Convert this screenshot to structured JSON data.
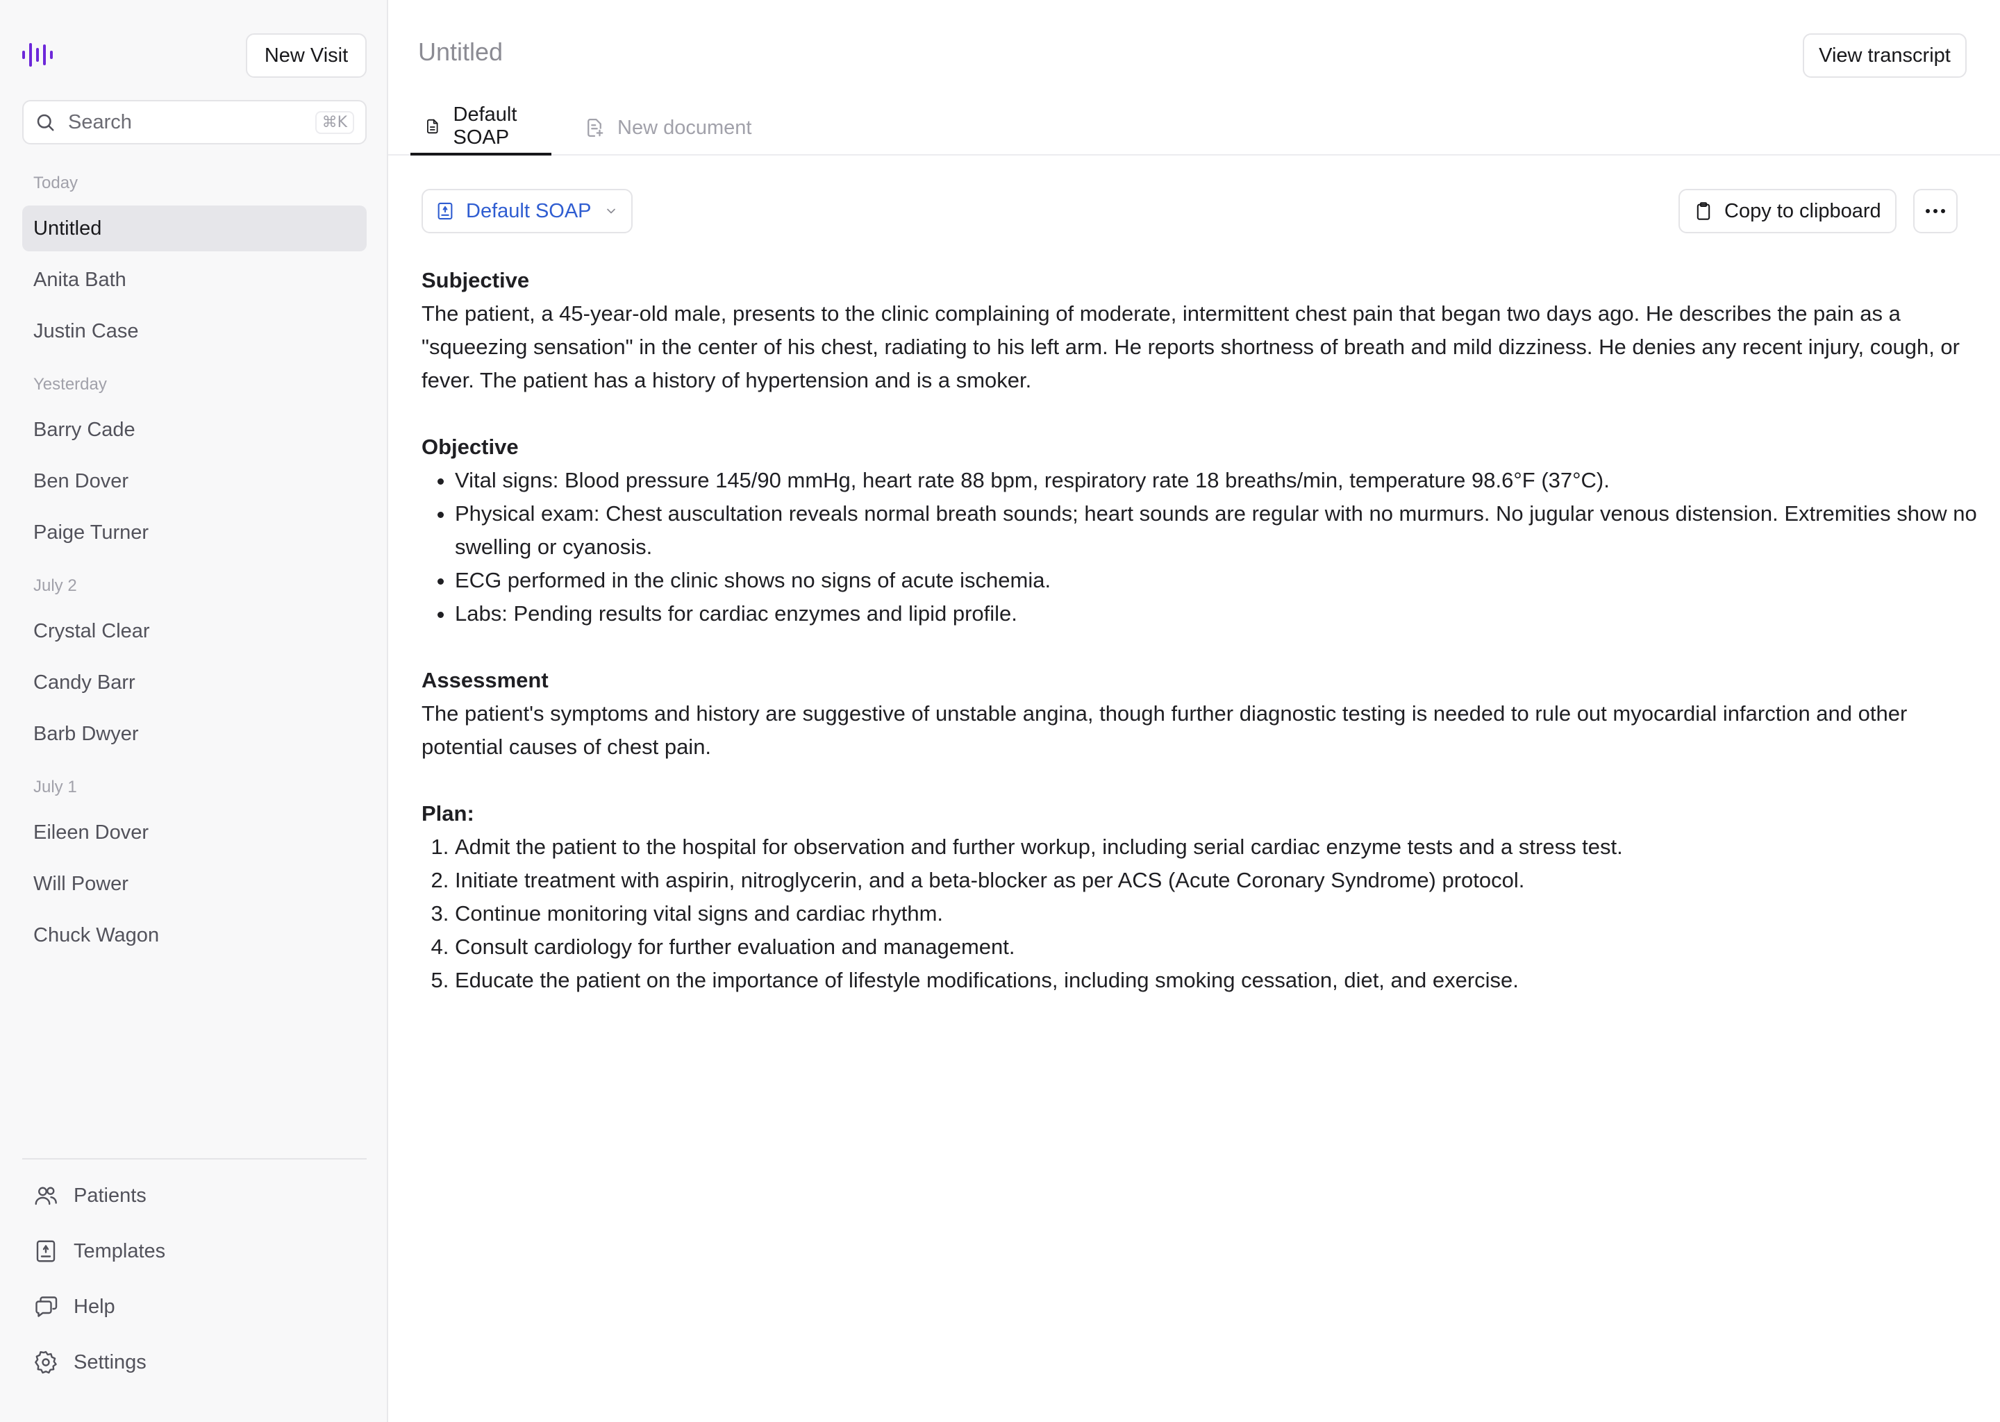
{
  "sidebar": {
    "new_visit_label": "New Visit",
    "search": {
      "placeholder": "Search",
      "shortcut": "⌘K"
    },
    "groups": [
      {
        "label": "Today",
        "items": [
          "Untitled",
          "Anita Bath",
          "Justin Case"
        ]
      },
      {
        "label": "Yesterday",
        "items": [
          "Barry Cade",
          "Ben Dover",
          "Paige Turner"
        ]
      },
      {
        "label": "July 2",
        "items": [
          "Crystal Clear",
          "Candy Barr",
          "Barb Dwyer"
        ]
      },
      {
        "label": "July 1",
        "items": [
          "Eileen Dover",
          "Will Power",
          "Chuck Wagon"
        ]
      }
    ],
    "footer": {
      "patients": "Patients",
      "templates": "Templates",
      "help": "Help",
      "settings": "Settings"
    },
    "active_item": "Untitled"
  },
  "header": {
    "title": "Untitled",
    "view_transcript_label": "View transcript"
  },
  "tabs": [
    {
      "label": "Default SOAP",
      "active": true
    },
    {
      "label": "New document",
      "active": false
    }
  ],
  "toolbar": {
    "template_label": "Default SOAP",
    "copy_label": "Copy to clipboard"
  },
  "note": {
    "subjective_heading": "Subjective",
    "subjective_text": "The patient, a 45-year-old male, presents to the clinic complaining of moderate, intermittent chest pain that began two days ago. He describes the pain as a \"squeezing sensation\" in the center of his chest, radiating to his left arm. He reports shortness of breath and mild dizziness. He denies any recent injury, cough, or fever. The patient has a history of hypertension and is a smoker.",
    "objective_heading": "Objective",
    "objective_items": [
      "Vital signs: Blood pressure 145/90 mmHg, heart rate 88 bpm, respiratory rate 18 breaths/min, temperature 98.6°F (37°C).",
      "Physical exam: Chest auscultation reveals normal breath sounds; heart sounds are regular with no murmurs. No jugular venous distension. Extremities show no swelling or cyanosis.",
      "ECG performed in the clinic shows no signs of acute ischemia.",
      "Labs: Pending results for cardiac enzymes and lipid profile."
    ],
    "assessment_heading": "Assessment",
    "assessment_text": "The patient's symptoms and history are suggestive of unstable angina, though further diagnostic testing is needed to rule out myocardial infarction and other potential causes of chest pain.",
    "plan_heading": "Plan:",
    "plan_items": [
      "Admit the patient to the hospital for observation and further workup, including serial cardiac enzyme tests and a stress test.",
      "Initiate treatment with aspirin, nitroglycerin, and a beta-blocker as per ACS (Acute Coronary Syndrome) protocol.",
      "Continue monitoring vital signs and cardiac rhythm.",
      "Consult cardiology for further evaluation and management.",
      "Educate the patient on the importance of lifestyle modifications, including smoking cessation, diet, and exercise."
    ]
  },
  "colors": {
    "brand": "#6d28d9",
    "link": "#2f5dd1",
    "active_bg": "#e6e6ea"
  },
  "icons": {
    "logo": "waveform-logo-icon",
    "search": "search-icon",
    "tab_document": "document-icon",
    "tab_new": "document-plus-icon",
    "template": "template-icon",
    "chevron": "chevron-down-icon",
    "copy": "clipboard-icon",
    "more": "ellipsis-icon",
    "patients": "users-icon",
    "templates": "template-icon",
    "help": "chat-icon",
    "settings": "gear-icon"
  }
}
